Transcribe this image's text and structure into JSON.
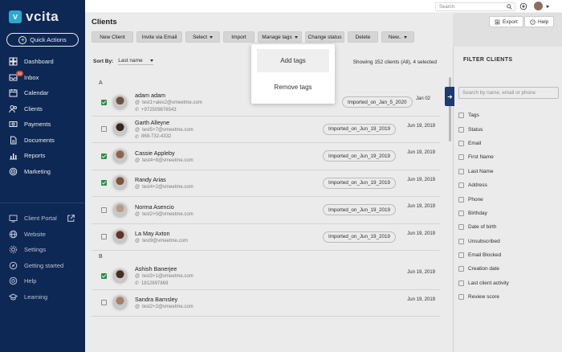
{
  "brand": {
    "name": "vcita",
    "mark": "v"
  },
  "quick_actions": {
    "label": "Quick Actions"
  },
  "nav": [
    {
      "label": "Dashboard",
      "icon": "dashboard-icon"
    },
    {
      "label": "Inbox",
      "icon": "inbox-icon",
      "badge": "36"
    },
    {
      "label": "Calendar",
      "icon": "calendar-icon"
    },
    {
      "label": "Clients",
      "icon": "clients-icon"
    },
    {
      "label": "Payments",
      "icon": "payments-icon"
    },
    {
      "label": "Documents",
      "icon": "documents-icon"
    },
    {
      "label": "Reports",
      "icon": "reports-icon"
    },
    {
      "label": "Marketing",
      "icon": "marketing-icon"
    }
  ],
  "nav_bottom": [
    {
      "label": "Client Portal",
      "icon": "portal-icon"
    },
    {
      "label": "Website",
      "icon": "globe-icon"
    },
    {
      "label": "Settings",
      "icon": "gear-icon"
    },
    {
      "label": "Getting started",
      "icon": "compass-icon"
    },
    {
      "label": "Help",
      "icon": "help-icon"
    },
    {
      "label": "Learning",
      "icon": "learning-icon"
    }
  ],
  "topbar": {
    "search_placeholder": "Search"
  },
  "page": {
    "title": "Clients",
    "export_label": "Export",
    "help_label": "Help"
  },
  "toolbar": [
    {
      "label": "New Client",
      "caret": false
    },
    {
      "label": "Invite via Email",
      "caret": false
    },
    {
      "label": "Select",
      "caret": true
    },
    {
      "label": "Import",
      "caret": false
    },
    {
      "label": "Manage tags",
      "caret": true
    },
    {
      "label": "Change status",
      "caret": false
    },
    {
      "label": "Delete",
      "caret": false
    },
    {
      "label": "New..",
      "caret": true
    }
  ],
  "sort": {
    "label": "Sort By:",
    "value": "Last name"
  },
  "showing": "Showing 152 clients (All), 4 selected",
  "manage_tags_menu": [
    "Add tags",
    "Remove tags"
  ],
  "groups": [
    {
      "letter": "A",
      "clients": [
        {
          "name": "adam adam",
          "email": "test1+alex2@vmeetme.com",
          "phone": "+972509876543",
          "tag": "Imported_on_Jan_5_2020",
          "date": "Jan 02",
          "checked": true,
          "avatar": "#7a5a44"
        }
      ]
    },
    {
      "letter": "",
      "clients": [
        {
          "name": "Garth Alleyne",
          "email": "test5+7@vmeetme.com",
          "phone": "868-732-4332",
          "tag": "Imported_on_Jun_19_2019",
          "date": "Jun 19, 2019",
          "checked": false,
          "avatar": "#3b2a22"
        },
        {
          "name": "Cassie Appleby",
          "email": "test4+8@vmeetme.com",
          "phone": "",
          "tag": "Imported_on_Jun_19_2019",
          "date": "Jun 19, 2019",
          "checked": true,
          "avatar": "#9b6d55"
        },
        {
          "name": "Randy Arias",
          "email": "test4+2@vmeetme.com",
          "phone": "",
          "tag": "Imported_on_Jun_19_2019",
          "date": "Jun 19, 2019",
          "checked": true,
          "avatar": "#8a5c3e"
        },
        {
          "name": "Norma Asencio",
          "email": "test2+0@vmeetme.com",
          "phone": "",
          "tag": "Imported_on_Jun_19_2019",
          "date": "Jun 19, 2019",
          "checked": false,
          "avatar": "#c9a98f"
        },
        {
          "name": "La May Axton",
          "email": "test9@vmeetme.com",
          "phone": "",
          "tag": "Imported_on_Jun_19_2019",
          "date": "Jun 19, 2019",
          "checked": false,
          "avatar": "#6a3a2c"
        }
      ]
    },
    {
      "letter": "B",
      "clients": [
        {
          "name": "Ashish Banerjee",
          "email": "test3+1@vmeetme.com",
          "phone": "1812697869",
          "tag": "",
          "date": "Jun 19, 2019",
          "checked": true,
          "avatar": "#4a3124"
        },
        {
          "name": "Sandra Barnsley",
          "email": "test2+2@vmeetme.com",
          "phone": "",
          "tag": "",
          "date": "Jun 19, 2019",
          "checked": false,
          "avatar": "#b48a72"
        }
      ]
    }
  ],
  "filter": {
    "title": "FILTER CLIENTS",
    "search_placeholder": "Search by name, email or phone",
    "options": [
      "Tags",
      "Status",
      "Email",
      "First Name",
      "Last Name",
      "Address",
      "Phone",
      "Birthday",
      "Date of birth",
      "Unsubscribed",
      "Email Blocked",
      "Creation date",
      "Last client activity",
      "Review score"
    ]
  }
}
